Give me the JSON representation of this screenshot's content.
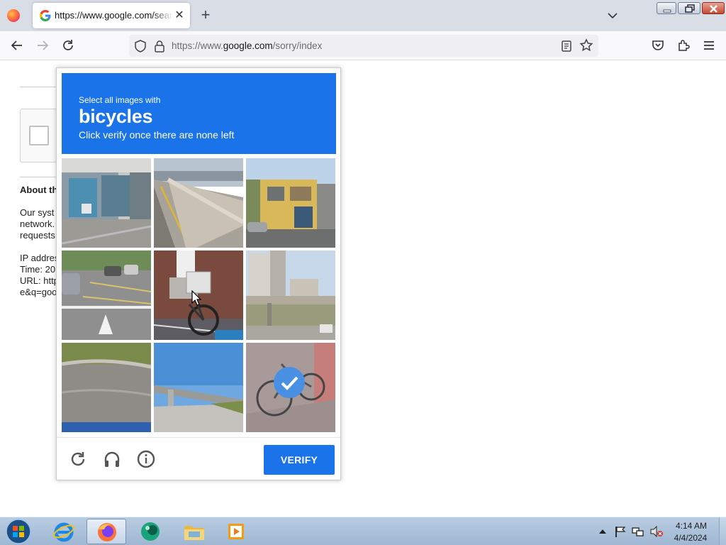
{
  "browser": {
    "tab_title": "https://www.google.com/search?q=google",
    "url_prefix": "https://www.",
    "url_domain": "google.com",
    "url_path": "/sorry/index"
  },
  "page_background": {
    "about_heading": "About th",
    "lines_1": [
      "Our syst",
      "network.",
      "requests"
    ],
    "lines_2": [
      "IP addres",
      "Time: 20",
      "URL: http",
      "e&q=goo"
    ]
  },
  "captcha": {
    "prompt_line1": "Select all images with",
    "target": "bicycles",
    "prompt_line2": "Click verify once there are none left",
    "selected_tiles": [
      9
    ],
    "verify_label": "VERIFY",
    "accent_color": "#1a73e8"
  },
  "taskbar": {
    "apps": [
      "internet-explorer",
      "firefox",
      "app-green",
      "file-explorer",
      "media-player"
    ],
    "active_app": "firefox",
    "time": "4:14 AM",
    "date": "4/4/2024"
  }
}
